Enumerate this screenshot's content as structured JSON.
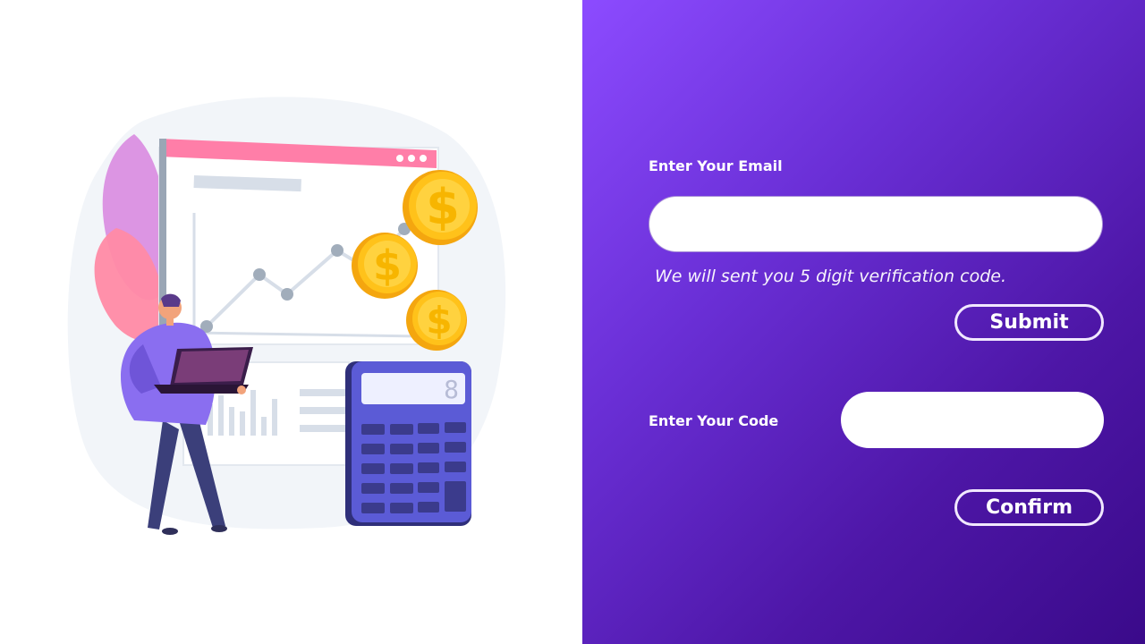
{
  "form": {
    "email_label": "Enter Your Email",
    "email_placeholder": "",
    "email_value": "",
    "hint": "We will sent you 5 digit verification code.",
    "submit_label": "Submit",
    "code_label": "Enter Your Code",
    "code_placeholder": "",
    "code_value": "",
    "confirm_label": "Confirm"
  },
  "illustration": {
    "calculator_display": "8",
    "coin_symbol": "$"
  },
  "colors": {
    "gradient_start": "#8c4bff",
    "gradient_end": "#3a0a8a",
    "button_border": "#f1e8ff",
    "accent_pink": "#ff7ea8",
    "coin_gold": "#ffc21a",
    "calculator_purple": "#5b5bd6"
  }
}
